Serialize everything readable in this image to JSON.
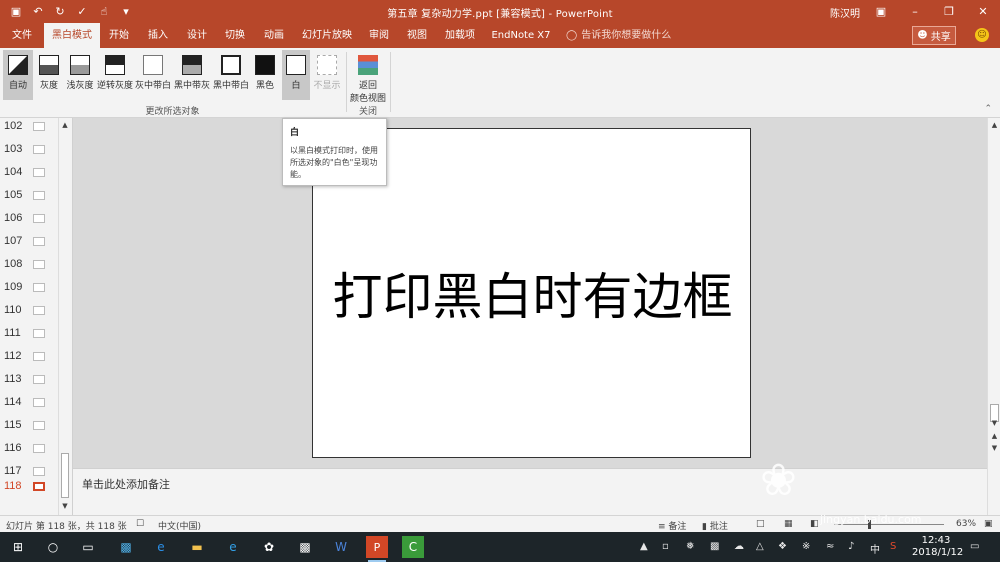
{
  "titlebar": {
    "doc_title": "第五章 复杂动力学.ppt [兼容模式]  -  PowerPoint",
    "user": "陈汉明"
  },
  "tabs": [
    "文件",
    "黑白模式",
    "开始",
    "插入",
    "设计",
    "切换",
    "动画",
    "幻灯片放映",
    "审阅",
    "视图",
    "加载项",
    "EndNote X7"
  ],
  "active_tab": "黑白模式",
  "tell_me": "告诉我你想要做什么",
  "share": "共享",
  "ribbon": {
    "buttons": [
      "自动",
      "灰度",
      "浅灰度",
      "逆转灰度",
      "灰中带白",
      "黑中带灰",
      "黑中带白",
      "黑色",
      "白",
      "不显示"
    ],
    "group_change": "更改所选对象",
    "return_l1": "返回",
    "return_l2": "颜色视图",
    "group_close": "关闭"
  },
  "thumbnails": [
    "102",
    "103",
    "104",
    "105",
    "106",
    "107",
    "108",
    "109",
    "110",
    "111",
    "112",
    "113",
    "114",
    "115",
    "116",
    "117",
    "118"
  ],
  "current_slide": "118",
  "slide": {
    "text": "打印黑白时有边框"
  },
  "tooltip": {
    "title": "白",
    "body": "以黑白模式打印时，使用所选对象的\"白色\"呈现功能。"
  },
  "notes": {
    "placeholder": "单击此处添加备注"
  },
  "status": {
    "slide_info": "幻灯片 第 118 张，共 118 张",
    "language": "中文(中国)",
    "notes": "备注",
    "comments": "批注",
    "zoom": "63%"
  },
  "taskbar": {
    "time": "12:43",
    "date": "2018/1/12",
    "ime": "中"
  },
  "watermark": {
    "text": "jingyan.baidu.com"
  },
  "colors": {
    "accent": "#b7472a",
    "ribbon_bg": "#f3f3f3",
    "current_thumb": "#d24726"
  }
}
